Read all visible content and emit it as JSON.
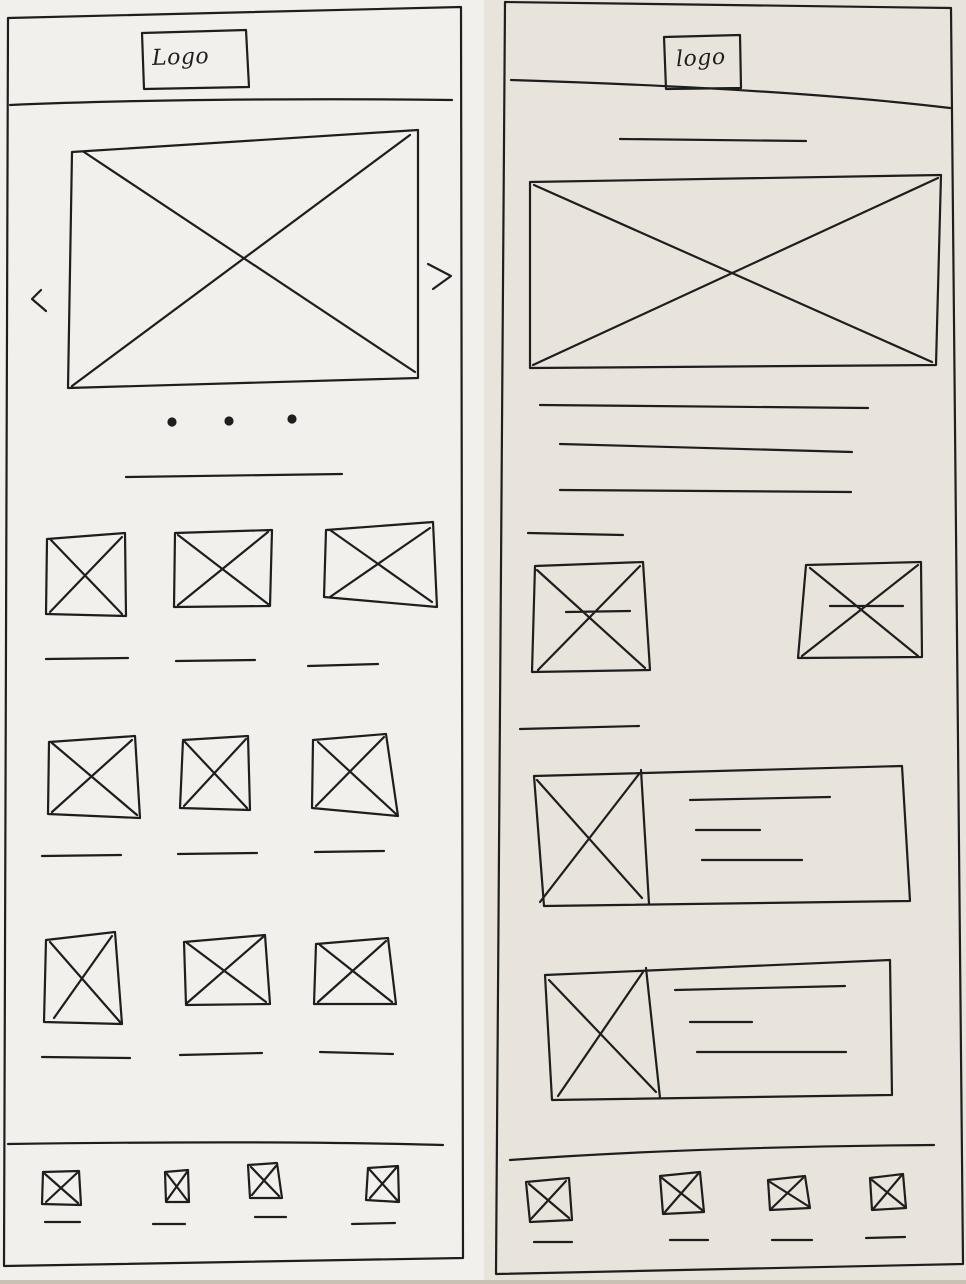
{
  "theme": {
    "ink": "#1e1e1e",
    "paper_left": "#f1f0ec",
    "paper_right": "#e9e4db",
    "background": "#c9c2b4"
  },
  "left_screen": {
    "header": {
      "logo": "Logo"
    },
    "carousel": {
      "prev_icon": "chevron-left-icon",
      "next_icon": "chevron-right-icon",
      "dots": 3
    },
    "grid": {
      "rows": 3,
      "columns": 3
    },
    "footer_tabs": 4
  },
  "right_screen": {
    "header": {
      "logo": "logo"
    },
    "featured_lines": 3,
    "two_col_items": 2,
    "list_cards": 2,
    "footer_tabs": 4
  }
}
